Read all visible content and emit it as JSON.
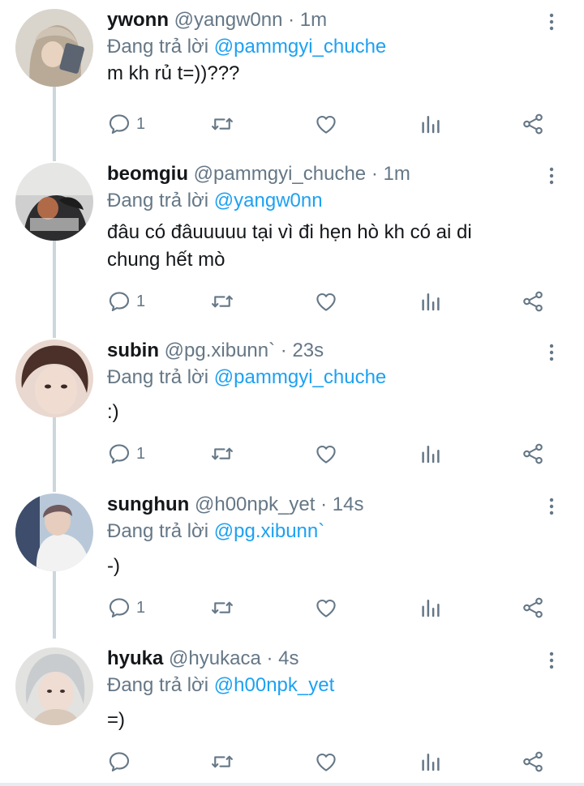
{
  "reply_prefix": "Đang trả lời",
  "colors": {
    "mention": "#1da1f2",
    "secondary_text": "#657786",
    "connector": "#ccd6dd"
  },
  "icons": {
    "reply": "reply-icon",
    "retweet": "retweet-icon",
    "like": "heart-icon",
    "stats": "stats-icon",
    "share": "share-icon",
    "more": "more-vertical-icon"
  },
  "tweets": [
    {
      "name": "ywonn",
      "handle": "@yangw0nn",
      "time": "· 1m",
      "replying_to": "@pammgyi_chuche",
      "text": "m kh rủ t=))???",
      "reply_count": "1"
    },
    {
      "name": "beomgiu",
      "handle": "@pammgyi_chuche",
      "time": "· 1m",
      "replying_to": "@yangw0nn",
      "text": "đâu có đâuuuuu tại vì đi hẹn hò kh có ai di chung hết mò",
      "reply_count": "1"
    },
    {
      "name": "subin",
      "handle": "@pg.xibunn`",
      "time": "· 23s",
      "replying_to": "@pammgyi_chuche",
      "text": ":)",
      "reply_count": "1"
    },
    {
      "name": "sunghun",
      "handle": "@h00npk_yet",
      "time": "· 14s",
      "replying_to": "@pg.xibunn`",
      "text": "-)",
      "reply_count": "1"
    },
    {
      "name": "hyuka",
      "handle": "@hyukaca",
      "time": "· 4s",
      "replying_to": "@h00npk_yet",
      "text": "=)",
      "reply_count": ""
    }
  ]
}
